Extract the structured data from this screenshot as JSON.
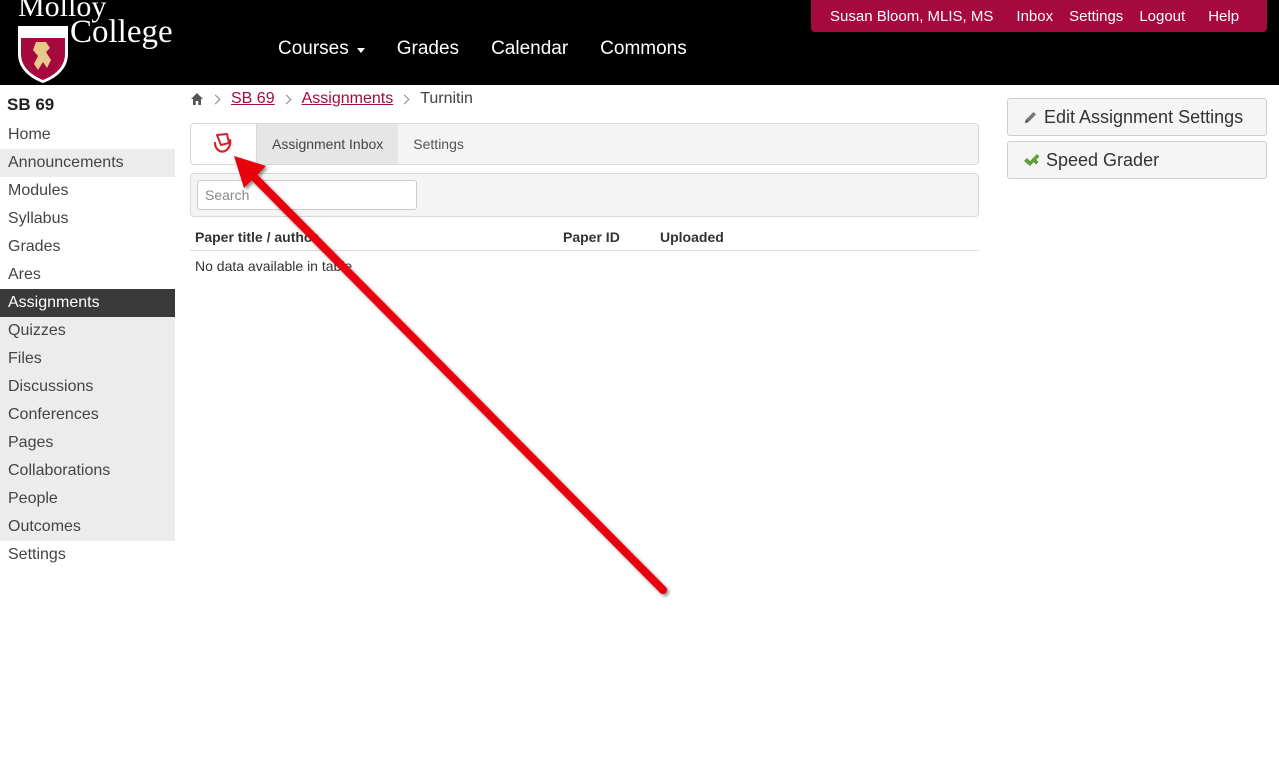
{
  "header": {
    "logo_line1": "Molloy",
    "logo_line2": "College",
    "global_nav": [
      {
        "label": "Courses",
        "has_caret": true
      },
      {
        "label": "Grades"
      },
      {
        "label": "Calendar"
      },
      {
        "label": "Commons"
      }
    ],
    "user_bar": {
      "user_name": "Susan Bloom, MLIS, MS",
      "inbox": "Inbox",
      "settings": "Settings",
      "logout": "Logout",
      "help": "Help"
    },
    "brand_color": "#a6093d"
  },
  "course_nav": {
    "course_title": "SB 69",
    "items": [
      {
        "label": "Home"
      },
      {
        "label": "Announcements"
      },
      {
        "label": "Modules"
      },
      {
        "label": "Syllabus"
      },
      {
        "label": "Grades"
      },
      {
        "label": "Ares"
      },
      {
        "label": "Assignments",
        "active": true
      },
      {
        "label": "Quizzes"
      },
      {
        "label": "Files"
      },
      {
        "label": "Discussions"
      },
      {
        "label": "Conferences"
      },
      {
        "label": "Pages"
      },
      {
        "label": "Collaborations"
      },
      {
        "label": "People"
      },
      {
        "label": "Outcomes"
      },
      {
        "label": "Settings"
      }
    ]
  },
  "breadcrumb": {
    "home_icon": "home-icon",
    "course": "SB 69",
    "assignments": "Assignments",
    "current": "Turnitin"
  },
  "turnitin": {
    "logo_icon": "turnitin-logo-icon",
    "tabs": [
      {
        "label": "Assignment Inbox",
        "active": true
      },
      {
        "label": "Settings"
      }
    ],
    "search_placeholder": "Search",
    "table": {
      "columns": [
        "Paper title / author",
        "Paper ID",
        "Uploaded"
      ],
      "empty_message": "No data available in table"
    }
  },
  "sidebar_actions": {
    "edit_settings": "Edit Assignment Settings",
    "edit_icon": "pencil-icon",
    "speed_grader": "Speed Grader",
    "speed_icon": "checkmark-icon"
  },
  "annotation": {
    "type": "arrow",
    "color": "#e8000d",
    "points_to": "turnitin-logo-icon"
  }
}
